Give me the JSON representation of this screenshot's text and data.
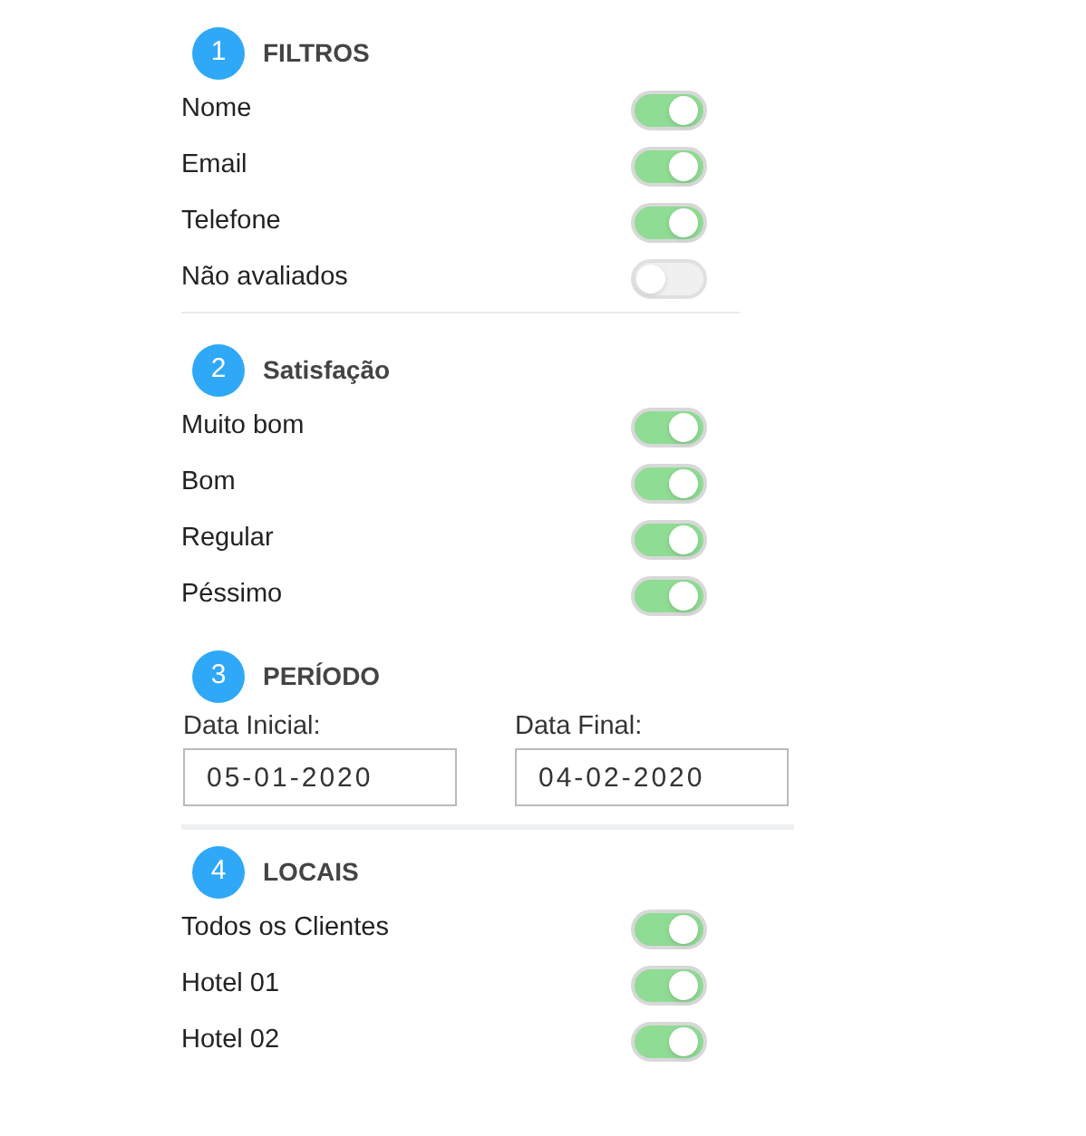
{
  "sections": [
    {
      "number": "1",
      "title": "FILTROS",
      "kind": "toggles",
      "divider": true,
      "items": [
        {
          "label": "Nome",
          "on": true
        },
        {
          "label": "Email",
          "on": true
        },
        {
          "label": "Telefone",
          "on": true
        },
        {
          "label": "Não avaliados",
          "on": false
        }
      ]
    },
    {
      "number": "2",
      "title": "Satisfação",
      "kind": "toggles",
      "divider": false,
      "items": [
        {
          "label": "Muito bom",
          "on": true
        },
        {
          "label": "Bom",
          "on": true
        },
        {
          "label": "Regular",
          "on": true
        },
        {
          "label": "Péssimo",
          "on": true
        }
      ]
    },
    {
      "number": "3",
      "title": "PERÍODO",
      "kind": "dates",
      "divider": true,
      "fields": [
        {
          "label": "Data Inicial:",
          "value": "05-01-2020"
        },
        {
          "label": "Data Final:",
          "value": "04-02-2020"
        }
      ]
    },
    {
      "number": "4",
      "title": "LOCAIS",
      "kind": "toggles",
      "divider": false,
      "items": [
        {
          "label": "Todos os Clientes",
          "on": true
        },
        {
          "label": "Hotel 01",
          "on": true
        },
        {
          "label": "Hotel 02",
          "on": true
        }
      ]
    }
  ]
}
